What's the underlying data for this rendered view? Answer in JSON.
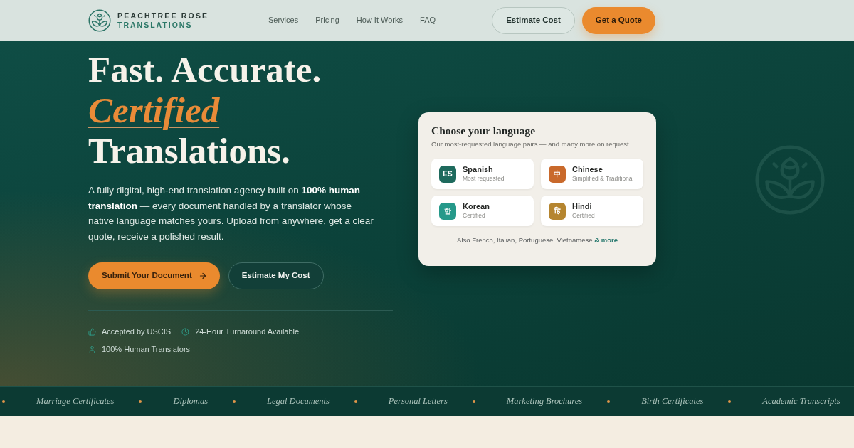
{
  "header": {
    "brand": {
      "name": "PEACHTREE ROSE",
      "tagline": "TRANSLATIONS"
    },
    "nav": [
      {
        "label": "Services"
      },
      {
        "label": "Pricing"
      },
      {
        "label": "How It Works"
      },
      {
        "label": "FAQ"
      }
    ],
    "actions": [
      {
        "label": "Estimate Cost",
        "kind": "outline"
      },
      {
        "label": "Get a Quote",
        "kind": "primary"
      }
    ]
  },
  "hero": {
    "headline": [
      {
        "text": "Fast. Accurate.",
        "kind": "plain"
      },
      {
        "text": "Certified",
        "kind": "accent"
      },
      {
        "text": "Translations.",
        "kind": "plain"
      }
    ],
    "intro": "A fully digital, high-end translation agency built on **100% human translation** — every document handled by a translator whose native language matches yours. Upload from anywhere, get a clear quote, receive a polished result.",
    "actions": [
      {
        "label": "Submit Your Document",
        "kind": "primary"
      },
      {
        "label": "Estimate My Cost",
        "kind": "outline"
      }
    ],
    "features": [
      {
        "label": "Accepted by USCIS"
      },
      {
        "label": "24-Hour Turnaround Available"
      },
      {
        "label": "100% Human Translators"
      }
    ]
  },
  "language_card": {
    "title": "Choose your language",
    "subtitle": "Our most-requested language pairs — and many more on request.",
    "languages": [
      {
        "code": "ES",
        "name": "Spanish",
        "note": "Most requested",
        "color": "#1e6a5d"
      },
      {
        "code": "中",
        "name": "Chinese",
        "note": "Simplified & Traditional",
        "color": "#c9692b"
      },
      {
        "code": "한",
        "name": "Korean",
        "note": "Certified",
        "color": "#25998a"
      },
      {
        "code": "हि",
        "name": "Hindi",
        "note": "Certified",
        "color": "#b5852f"
      }
    ],
    "footer": "Also French, Italian, Portuguese, Vietnamese",
    "footer_link": "& more"
  },
  "document_ticker": {
    "items": [
      "Marriage Certificates",
      "Diplomas",
      "Legal Documents",
      "Personal Letters",
      "Marketing Brochures",
      "Birth Certificates",
      "Academic Transcripts"
    ]
  }
}
